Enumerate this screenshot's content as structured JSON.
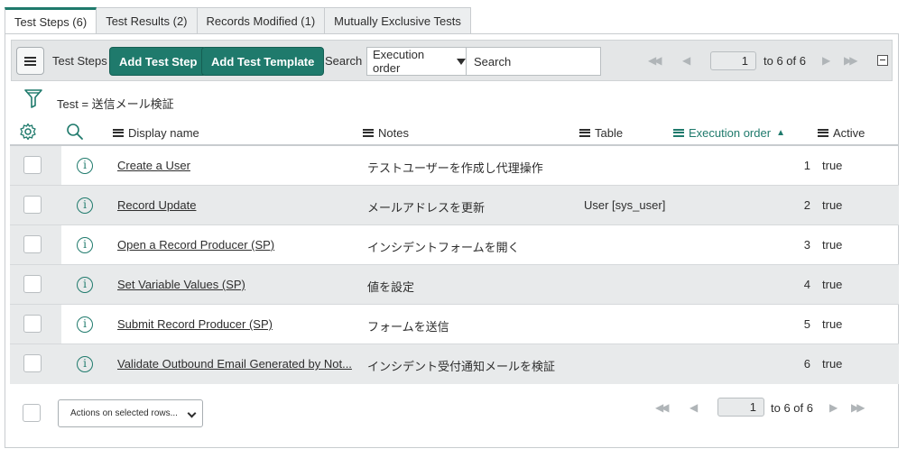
{
  "tabs": [
    {
      "label": "Test Steps (6)",
      "active": true
    },
    {
      "label": "Test Results (2)",
      "active": false
    },
    {
      "label": "Records Modified (1)",
      "active": false
    },
    {
      "label": "Mutually Exclusive Tests",
      "active": false
    }
  ],
  "toolbar": {
    "list_title": "Test Steps",
    "add_step_label": "Add Test Step",
    "add_template_label": "Add Test Template",
    "search_label": "Search",
    "search_field": "Execution order",
    "search_placeholder": "Search",
    "page": "1",
    "page_of": "to 6 of 6"
  },
  "filter": {
    "breadcrumb": "Test = 送信メール検証"
  },
  "columns": {
    "display_name": "Display name",
    "notes": "Notes",
    "table": "Table",
    "execution_order": "Execution order",
    "active": "Active"
  },
  "rows": [
    {
      "name": "Create a User",
      "notes": "テストユーザーを作成し代理操作",
      "table": "",
      "order": "1",
      "active": "true"
    },
    {
      "name": "Record Update",
      "notes": "メールアドレスを更新",
      "table": "User [sys_user]",
      "order": "2",
      "active": "true"
    },
    {
      "name": "Open a Record Producer (SP)",
      "notes": "インシデントフォームを開く",
      "table": "",
      "order": "3",
      "active": "true"
    },
    {
      "name": "Set Variable Values (SP)",
      "notes": "値を設定",
      "table": "",
      "order": "4",
      "active": "true"
    },
    {
      "name": "Submit Record Producer (SP)",
      "notes": "フォームを送信",
      "table": "",
      "order": "5",
      "active": "true"
    },
    {
      "name": "Validate Outbound Email Generated by Not...",
      "notes": "インシデント受付通知メールを検証",
      "table": "",
      "order": "6",
      "active": "true"
    }
  ],
  "footer": {
    "actions_label": "Actions on selected rows...",
    "page": "1",
    "page_of": "to 6 of 6"
  },
  "colors": {
    "accent": "#1f7a6c",
    "toolbar_bg": "#e4e6e7",
    "row_alt_bg": "#e8eaeb"
  },
  "icons": {
    "menu": "hamburger-icon",
    "filter": "funnel-icon",
    "settings": "gear-icon",
    "search": "search-icon",
    "info": "info-icon",
    "first": "first-page-icon",
    "prev": "prev-page-icon",
    "next": "next-page-icon",
    "last": "last-page-icon"
  }
}
